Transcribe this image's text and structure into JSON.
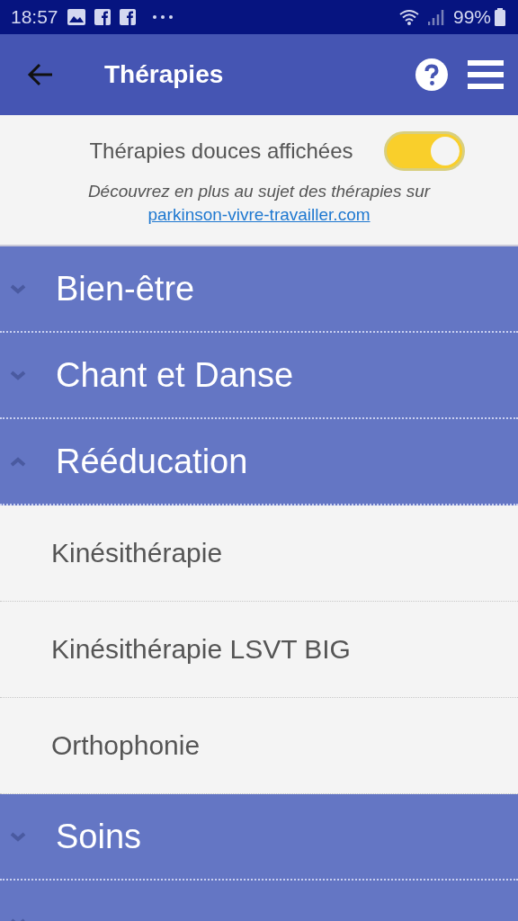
{
  "status_bar": {
    "time": "18:57",
    "battery": "99%"
  },
  "app_bar": {
    "title": "Thérapies"
  },
  "filter": {
    "label": "Thérapies douces affichées",
    "on": true,
    "note": "Découvrez en plus au sujet des thérapies sur",
    "link": "parkinson-vivre-travailler.com"
  },
  "groups": [
    {
      "label": "Bien-être",
      "expanded": false
    },
    {
      "label": "Chant et Danse",
      "expanded": false
    },
    {
      "label": "Rééducation",
      "expanded": true,
      "children": [
        {
          "label": "Kinésithérapie"
        },
        {
          "label": "Kinésithérapie LSVT BIG"
        },
        {
          "label": "Orthophonie"
        }
      ]
    },
    {
      "label": "Soins",
      "expanded": false
    },
    {
      "expanded": false
    }
  ]
}
